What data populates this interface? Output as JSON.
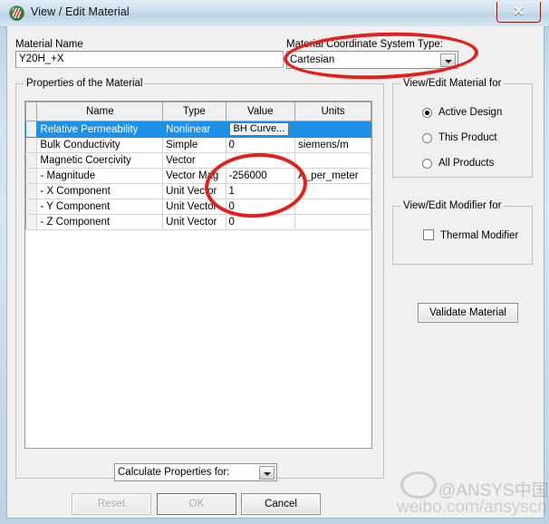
{
  "window": {
    "title": "View / Edit Material",
    "app_icon": "ansys-icon",
    "close_label": "✕"
  },
  "material_name": {
    "label": "Material Name",
    "value": "Y20H_+X"
  },
  "coord_system": {
    "label": "Material Coordinate System Type:",
    "value": "Cartesian"
  },
  "properties": {
    "group_title": "Properties of the Material",
    "columns": [
      "",
      "Name",
      "Type",
      "Value",
      "Units"
    ],
    "rows": [
      {
        "name": "Relative Permeability",
        "type": "Nonlinear",
        "value": "BH Curve...",
        "units": "",
        "selected": true,
        "value_is_button": true
      },
      {
        "name": "Bulk Conductivity",
        "type": "Simple",
        "value": "0",
        "units": "siemens/m",
        "selected": false,
        "value_is_button": false
      },
      {
        "name": "Magnetic Coercivity",
        "type": "Vector",
        "value": "",
        "units": "",
        "selected": false,
        "value_is_button": false
      },
      {
        "name": "-  Magnitude",
        "type": "Vector Mag",
        "value": "-256000",
        "units": "A_per_meter",
        "selected": false,
        "value_is_button": false
      },
      {
        "name": "-  X Component",
        "type": "Unit Vector",
        "value": "1",
        "units": "",
        "selected": false,
        "value_is_button": false
      },
      {
        "name": "-  Y Component",
        "type": "Unit Vector",
        "value": "0",
        "units": "",
        "selected": false,
        "value_is_button": false
      },
      {
        "name": "-  Z Component",
        "type": "Unit Vector",
        "value": "0",
        "units": "",
        "selected": false,
        "value_is_button": false
      }
    ]
  },
  "view_edit_material_for": {
    "group_title": "View/Edit Material for",
    "options": [
      {
        "label": "Active Design",
        "selected": true
      },
      {
        "label": "This Product",
        "selected": false
      },
      {
        "label": "All Products",
        "selected": false
      }
    ]
  },
  "view_edit_modifier_for": {
    "group_title": "View/Edit Modifier for",
    "checkbox_label": "Thermal Modifier",
    "checked": false
  },
  "validate_button": {
    "label": "Validate Material"
  },
  "calculate_properties": {
    "label": "Calculate Properties for:"
  },
  "footer_buttons": {
    "reset": {
      "label": "Reset",
      "enabled": false
    },
    "ok": {
      "label": "OK",
      "enabled": false
    },
    "cancel": {
      "label": "Cancel",
      "enabled": true
    }
  },
  "watermark": {
    "line1": "@ANSYS中国",
    "line2": "weibo.com/ansyscn"
  },
  "colors": {
    "selection_blue": "#1e90e8",
    "annotation_red": "#e2211c",
    "close_red": "#d7342a"
  }
}
